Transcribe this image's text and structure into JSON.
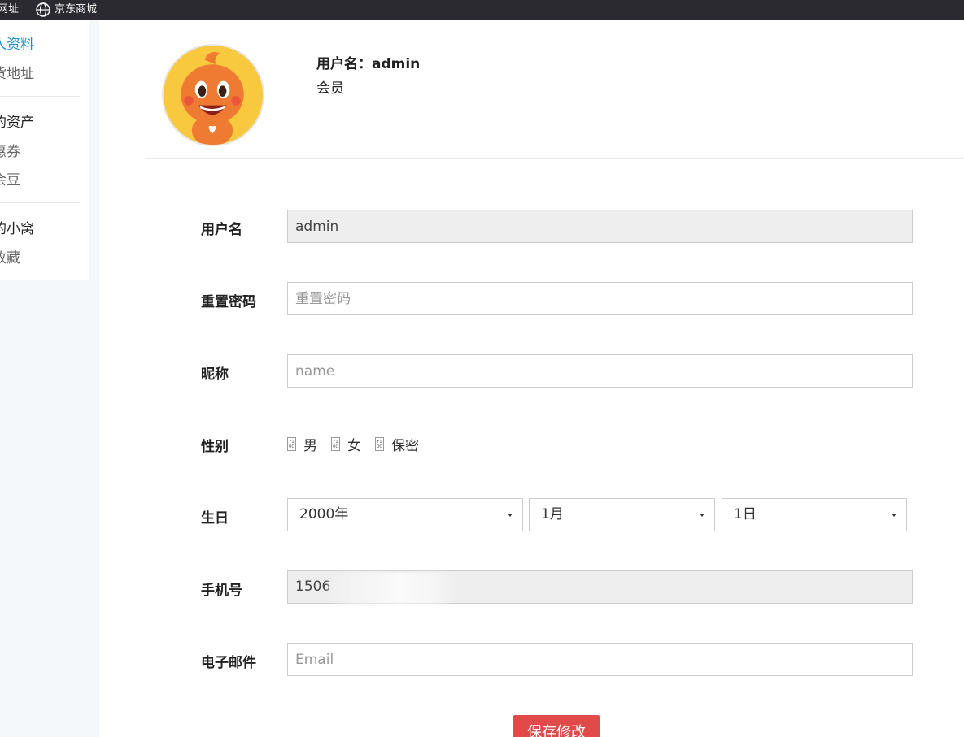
{
  "topbar": {
    "address_label": "网址",
    "jd_label": "京东商城"
  },
  "sidebar": {
    "groups": [
      {
        "items": [
          "人资料",
          "货地址"
        ]
      },
      {
        "title": "的资产",
        "items": [
          "惠券",
          "会豆"
        ]
      },
      {
        "title": "的小窝",
        "items": [
          "收藏"
        ]
      }
    ]
  },
  "profile": {
    "username_line": "用户名：admin",
    "level": "会员"
  },
  "form": {
    "username": {
      "label": "用户名",
      "value": "admin"
    },
    "password": {
      "label": "重置密码",
      "placeholder": "重置密码"
    },
    "nickname": {
      "label": "昵称",
      "placeholder": "name"
    },
    "gender": {
      "label": "性别",
      "glyph": "F1 0C",
      "options": [
        "男",
        "女",
        "保密"
      ]
    },
    "birthday": {
      "label": "生日",
      "year": "2000年",
      "month": "1月",
      "day": "1日"
    },
    "phone": {
      "label": "手机号",
      "value": "1506"
    },
    "email": {
      "label": "电子邮件",
      "placeholder": "Email"
    },
    "save_label": "保存修改"
  },
  "colors": {
    "accent": "#1a8fd1",
    "save_button": "#e04b4a",
    "topbar": "#2b2a30"
  }
}
